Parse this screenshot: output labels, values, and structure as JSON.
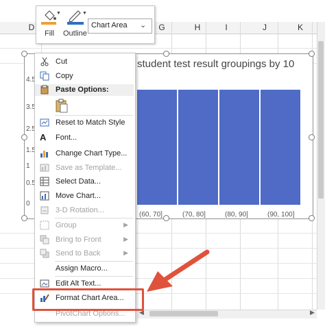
{
  "columns": [
    "D",
    "G",
    "H",
    "I",
    "J",
    "K"
  ],
  "toolbar": {
    "fill_label": "Fill",
    "outline_label": "Outline",
    "selection_value": "Chart Area"
  },
  "chart": {
    "title": "student test result groupings by 10",
    "y_ticks": [
      "4.5",
      "3.5",
      "2.5",
      "1.5",
      "1",
      "0.5",
      "0"
    ]
  },
  "chart_data": {
    "type": "bar",
    "title": "student test result groupings by 10",
    "categories": [
      "(60, 70]",
      "(70, 80]",
      "(80, 90]",
      "(90, 100]"
    ],
    "values": [
      4.5,
      4.5,
      4.5,
      4.5
    ],
    "ylim": [
      0,
      5
    ],
    "grid": false,
    "bar_color": "#4f6bc6"
  },
  "context_menu": {
    "items": [
      {
        "label": "Cut",
        "icon": "scissors-icon",
        "disabled": false
      },
      {
        "label": "Copy",
        "icon": "copy-icon",
        "disabled": false
      },
      {
        "label": "Paste Options:",
        "icon": "paste-icon",
        "disabled": false
      },
      {
        "label": "Reset to Match Style",
        "icon": "reset-style-icon",
        "disabled": false
      },
      {
        "label": "Font...",
        "icon": "font-icon",
        "disabled": false
      },
      {
        "label": "Change Chart Type...",
        "icon": "chart-type-icon",
        "disabled": false
      },
      {
        "label": "Save as Template...",
        "icon": "template-icon",
        "disabled": true
      },
      {
        "label": "Select Data...",
        "icon": "select-data-icon",
        "disabled": false
      },
      {
        "label": "Move Chart...",
        "icon": "move-chart-icon",
        "disabled": false
      },
      {
        "label": "3-D Rotation...",
        "icon": "rotation-icon",
        "disabled": true
      },
      {
        "label": "Group",
        "icon": "group-icon",
        "disabled": true
      },
      {
        "label": "Bring to Front",
        "icon": "bring-front-icon",
        "disabled": true
      },
      {
        "label": "Send to Back",
        "icon": "send-back-icon",
        "disabled": true
      },
      {
        "label": "Assign Macro...",
        "icon": "",
        "disabled": false
      },
      {
        "label": "Edit Alt Text...",
        "icon": "alt-text-icon",
        "disabled": false
      },
      {
        "label": "Format Chart Area...",
        "icon": "format-chart-icon",
        "disabled": false
      },
      {
        "label": "PivotChart Options...",
        "icon": "",
        "disabled": true
      }
    ]
  },
  "colors": {
    "accent_red": "#e0523b",
    "bar_blue": "#4f6bc6",
    "fill_orange": "#f0a030",
    "outline_blue": "#2f6fc0"
  }
}
